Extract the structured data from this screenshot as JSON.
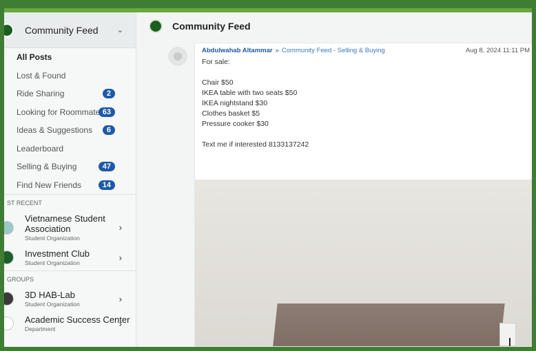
{
  "sidebar": {
    "header": {
      "title": "Community Feed"
    },
    "items": [
      {
        "label": "All Posts",
        "badge": ""
      },
      {
        "label": "Lost & Found",
        "badge": ""
      },
      {
        "label": "Ride Sharing",
        "badge": "2"
      },
      {
        "label": "Looking for Roommates",
        "badge": "63"
      },
      {
        "label": "Ideas & Suggestions",
        "badge": "6"
      },
      {
        "label": "Leaderboard",
        "badge": ""
      },
      {
        "label": "Selling & Buying",
        "badge": "47"
      },
      {
        "label": "Find New Friends",
        "badge": "14"
      }
    ],
    "recent_label": "ST RECENT",
    "recent": [
      {
        "name": "Vietnamese Student Association",
        "sub": "Student Organization",
        "color": "#9bc7c7"
      },
      {
        "name": "Investment Club",
        "sub": "Student Organization",
        "color": "#1d5f2a"
      }
    ],
    "groups_label": "GROUPS",
    "groups": [
      {
        "name": "3D HAB-Lab",
        "sub": "Student Organization",
        "color": "#3a3a3a"
      },
      {
        "name": "Academic Success Center",
        "sub": "Department",
        "color": "#ffffff"
      }
    ]
  },
  "main": {
    "header": {
      "title": "Community Feed"
    },
    "post": {
      "author": "Abdulwahab Altammar",
      "separator": "»",
      "channel": "Community Feed - Selling & Buying",
      "timestamp": "Aug 8, 2024 11:11 PM",
      "lines": [
        "For sale:",
        "",
        "Chair $50",
        "IKEA table with two seats $50",
        "IKEA nightstand $30",
        "Clothes basket $5",
        "Pressure cooker $30",
        "",
        "Text me if interested 8133137242"
      ]
    }
  },
  "colors": {
    "frame": "#3f7d34",
    "accent_top": "#69a83b",
    "badge": "#1e5aa8",
    "link": "#1e5aa8"
  }
}
